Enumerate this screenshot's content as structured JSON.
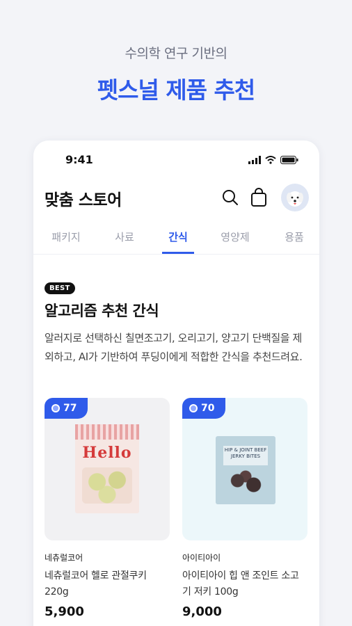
{
  "hero": {
    "subtitle": "수의학 연구 기반의",
    "title": "펫스널 제품 추천"
  },
  "status_bar": {
    "time": "9:41"
  },
  "app_bar": {
    "title": "맞춤 스토어",
    "icons": [
      "search-icon",
      "shopping-bag-icon",
      "profile-avatar"
    ]
  },
  "tabs": [
    {
      "label": "패키지",
      "active": false
    },
    {
      "label": "사료",
      "active": false
    },
    {
      "label": "간식",
      "active": true
    },
    {
      "label": "영양제",
      "active": false
    },
    {
      "label": "용품",
      "active": false
    }
  ],
  "section": {
    "badge": "BEST",
    "title": "알고리즘 추천 간식",
    "description": "알러지로 선택하신 칠면조고기, 오리고기, 양고기 단백질을 제외하고, AI가 기반하여 푸딩이에게 적합한 간식을 추천드려요."
  },
  "products": [
    {
      "score": "77",
      "brand": "네츄럴코어",
      "name": "네츄럴코어 헬로 관절쿠키 220g",
      "price": "5,900",
      "package_text": "Hello"
    },
    {
      "score": "70",
      "brand": "아이티아이",
      "name": "아이티아이 힙 앤 조인트 소고기 저키 100g",
      "price": "9,000",
      "package_text": "HIP & JOINT BEEF JERKY BITES"
    }
  ],
  "colors": {
    "accent": "#2f5bea",
    "background": "#f3f4f8"
  }
}
